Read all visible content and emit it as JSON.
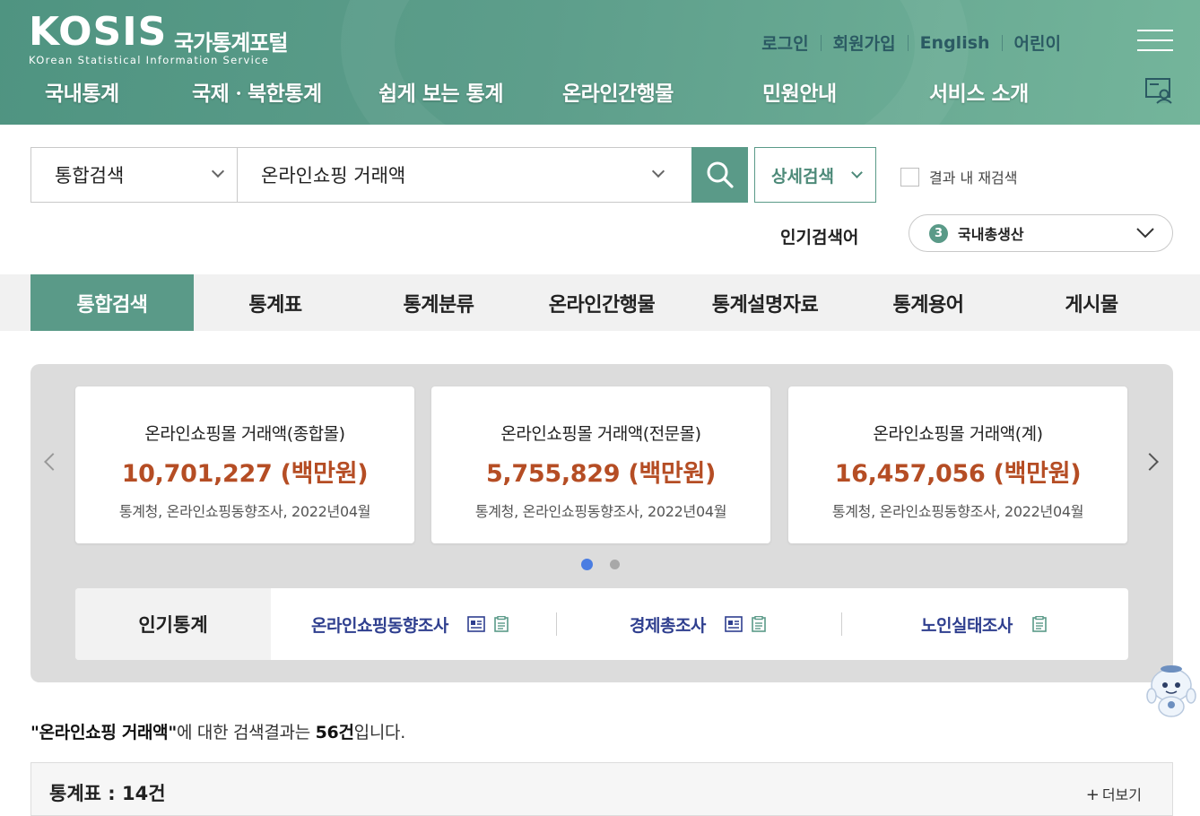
{
  "header": {
    "logo": "KOSIS",
    "logo_kr": "국가통계포털",
    "logo_sub": "KOrean Statistical Information Service",
    "util": [
      "로그인",
      "회원가입",
      "English",
      "어린이"
    ],
    "gnb": [
      "국내통계",
      "국제ㆍ북한통계",
      "쉽게 보는 통계",
      "온라인간행물",
      "민원안내",
      "서비스 소개"
    ]
  },
  "search": {
    "scope": "통합검색",
    "query": "온라인쇼핑 거래액",
    "detail_label": "상세검색",
    "recheck_label": "결과 내 재검색",
    "popular_label": "인기검색어",
    "popular_rank": "3",
    "popular_term": "국내총생산"
  },
  "tabs": [
    "통합검색",
    "통계표",
    "통계분류",
    "온라인간행물",
    "통계설명자료",
    "통계용어",
    "게시물"
  ],
  "cards": [
    {
      "title": "온라인쇼핑몰 거래액(종합몰)",
      "value": "10,701,227 (백만원)",
      "source": "통계청, 온라인쇼핑동향조사, 2022년04월"
    },
    {
      "title": "온라인쇼핑몰 거래액(전문몰)",
      "value": "5,755,829 (백만원)",
      "source": "통계청, 온라인쇼핑동향조사, 2022년04월"
    },
    {
      "title": "온라인쇼핑몰 거래액(계)",
      "value": "16,457,056 (백만원)",
      "source": "통계청, 온라인쇼핑동향조사, 2022년04월"
    }
  ],
  "popular_stats": {
    "label": "인기통계",
    "items": [
      "온라인쇼핑동향조사",
      "경제총조사",
      "노인실태조사"
    ]
  },
  "result": {
    "summary_query": "\"온라인쇼핑 거래액\"",
    "summary_mid": "에 대한 검색결과는 ",
    "summary_count": "56건",
    "summary_end": "입니다.",
    "section_title": "통계표 : 14건",
    "more_label": "더보기"
  },
  "colors": {
    "brand": "#5a9a88",
    "value": "#b54d24",
    "link": "#2f3f8f",
    "dot_active": "#4a7de2"
  }
}
